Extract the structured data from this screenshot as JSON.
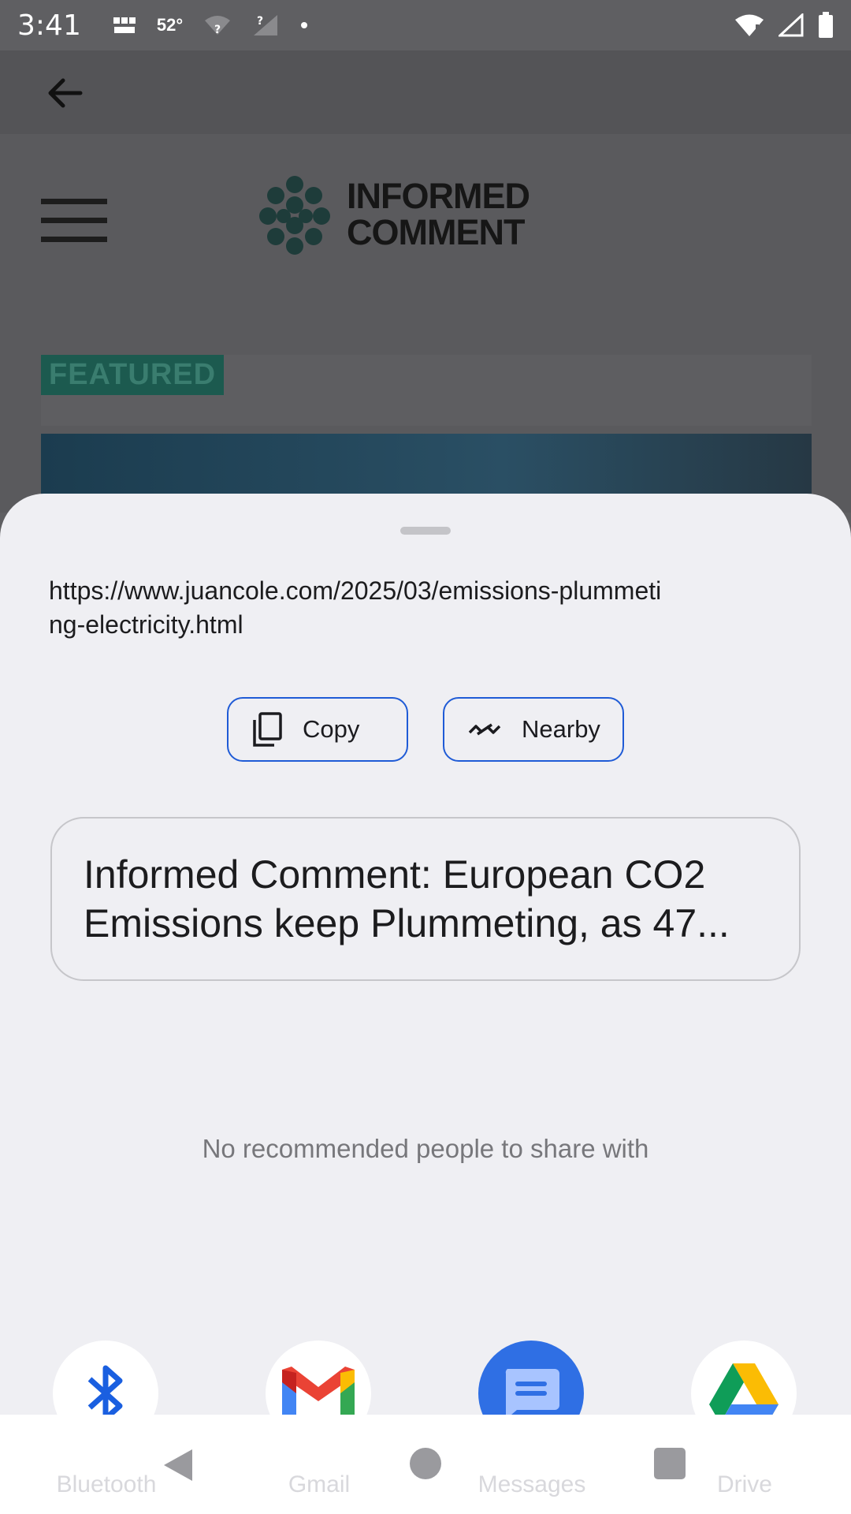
{
  "status_bar": {
    "time": "3:41",
    "temperature": "52°",
    "icons_left": [
      "bbc-news-icon",
      "wifi-question-icon",
      "signal-question-icon",
      "dot-icon"
    ],
    "icons_right": [
      "wifi-icon",
      "signal-icon",
      "battery-icon"
    ]
  },
  "background_page": {
    "logo_line1": "INFORMED",
    "logo_line2": "COMMENT",
    "featured_label": "FEATURED"
  },
  "share_sheet": {
    "url": "https://www.juancole.com/2025/03/emissions-plummeting-electricity.html",
    "actions": [
      {
        "label": "Copy",
        "icon": "copy-icon"
      },
      {
        "label": "Nearby",
        "icon": "nearby-share-icon"
      }
    ],
    "preview_title": "Informed Comment: European CO2 Emissions keep Plummeting, as 47...",
    "empty_people_message": "No recommended people to share with",
    "apps": [
      {
        "label": "Bluetooth",
        "icon": "bluetooth-icon"
      },
      {
        "label": "Gmail",
        "icon": "gmail-icon"
      },
      {
        "label": "Messages",
        "icon": "messages-icon"
      },
      {
        "label": "Drive",
        "icon": "drive-icon"
      }
    ]
  },
  "colors": {
    "accent": "#1f5bd6",
    "sheet_background": "#efeff3",
    "featured_green": "#1c5a4f"
  }
}
